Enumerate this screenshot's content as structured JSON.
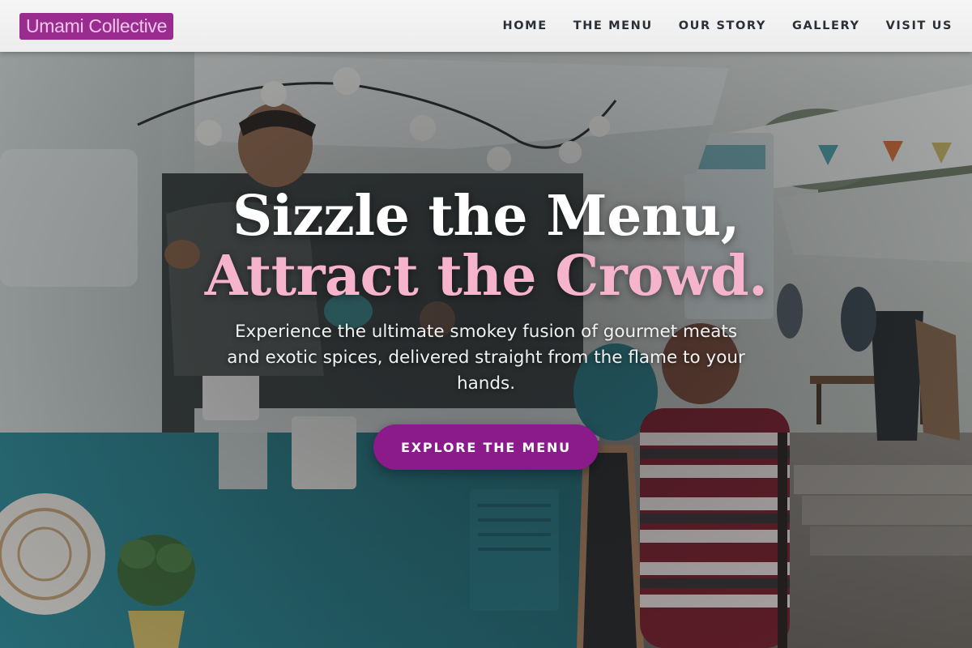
{
  "header": {
    "brand": "Umami Collective",
    "nav": [
      {
        "label": "HOME"
      },
      {
        "label": "THE MENU"
      },
      {
        "label": "OUR STORY"
      },
      {
        "label": "GALLERY"
      },
      {
        "label": "VISIT US"
      }
    ]
  },
  "hero": {
    "headline_line1": "Sizzle the Menu,",
    "headline_line2": "Attract the Crowd.",
    "subtext": "Experience the ultimate smokey fusion of gourmet meats and exotic spices, delivered straight from the flame to your hands.",
    "cta_label": "EXPLORE THE MENU"
  },
  "colors": {
    "brand_bg": "#9b2c8f",
    "brand_text": "#f2c6ea",
    "accent_pink": "#f6b3cc",
    "cta_bg": "#8b1a8a",
    "truck_teal": "#2f8e9c"
  },
  "icons": {
    "string_lights": "bulb-light-icon",
    "plant": "potted-plant-icon"
  }
}
